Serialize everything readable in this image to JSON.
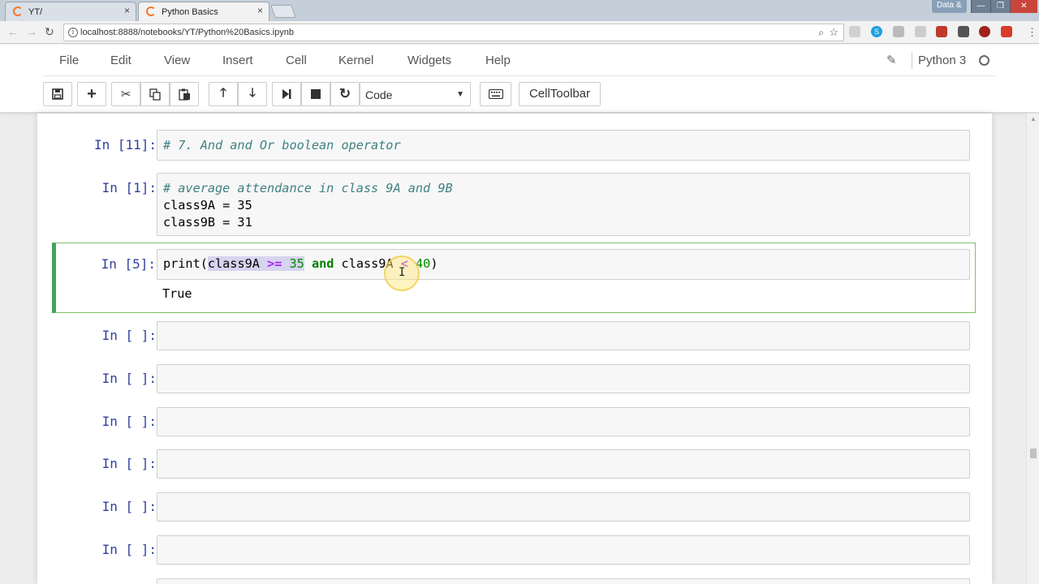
{
  "browser": {
    "tabs": [
      {
        "title": "YT/",
        "close": "×"
      },
      {
        "title": "Python Basics",
        "close": "×"
      }
    ],
    "profile": "Data &",
    "window_controls": [
      "—",
      "❐",
      "✕"
    ],
    "url": "localhost:8888/notebooks/YT/Python%20Basics.ipynb"
  },
  "jupyter": {
    "menu": [
      "File",
      "Edit",
      "View",
      "Insert",
      "Cell",
      "Kernel",
      "Widgets",
      "Help"
    ],
    "kernel_name": "Python 3",
    "toolbar": {
      "cell_type": "Code",
      "celltoolbar_label": "CellToolbar"
    }
  },
  "cells": [
    {
      "prompt": "In [11]:",
      "lines": [
        "# 7. And and Or boolean operator"
      ]
    },
    {
      "prompt": "In [1]:",
      "lines": [
        "# average attendance in class 9A and 9B",
        "class9A = 35",
        "class9B = 31"
      ]
    },
    {
      "prompt": "In [5]:",
      "code": {
        "fn_open": "print(",
        "var1": "class9A",
        "op1": ">=",
        "num1": "35",
        "kw": "and",
        "var2": "class9A",
        "op2": "<",
        "num2": "40",
        "close": ")"
      },
      "output": "True"
    },
    {
      "prompt": "In [ ]:"
    },
    {
      "prompt": "In [ ]:"
    },
    {
      "prompt": "In [ ]:"
    },
    {
      "prompt": "In [ ]:"
    },
    {
      "prompt": "In [ ]:"
    },
    {
      "prompt": "In [ ]:"
    }
  ],
  "colors": {
    "prompt": "#303f9f",
    "comment": "#408080",
    "number": "#008800",
    "operator": "#aa22ff",
    "keyword": "#008000",
    "selected_cell_border": "#42a55a"
  }
}
